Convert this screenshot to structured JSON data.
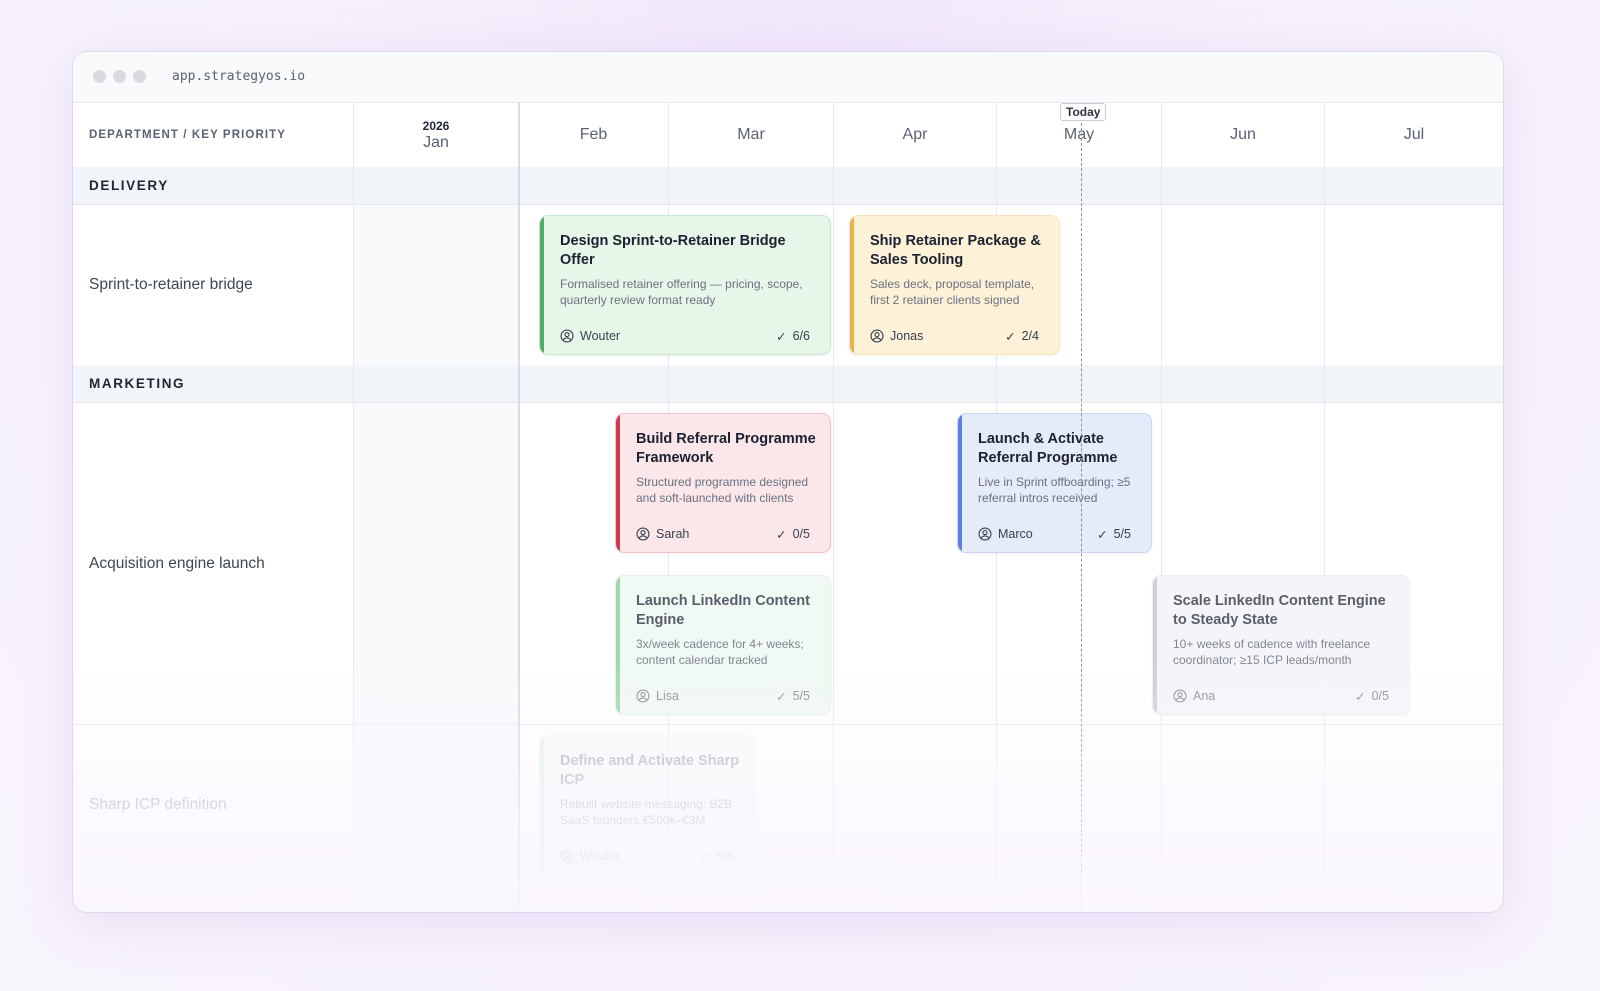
{
  "window": {
    "url": "app.strategyos.io"
  },
  "timeline": {
    "header_label": "DEPARTMENT / KEY PRIORITY",
    "year": "2026",
    "months": [
      "Jan",
      "Feb",
      "Mar",
      "Apr",
      "May",
      "Jun",
      "Jul"
    ],
    "today_label": "Today"
  },
  "sections": [
    {
      "name": "DELIVERY",
      "priorities": [
        {
          "label": "Sprint-to-retainer bridge",
          "cards": [
            {
              "title": "Design Sprint-to-Retainer Bridge Offer",
              "description": "Formalised retainer offering — pricing, scope, quarterly review format ready",
              "owner": "Wouter",
              "progress": "6/6",
              "accent": "#4caf63",
              "fill": "#e6f7ea"
            },
            {
              "title": "Ship Retainer Package & Sales Tooling",
              "description": "Sales deck, proposal template, first 2 retainer clients signed",
              "owner": "Jonas",
              "progress": "2/4",
              "accent": "#e8b44a",
              "fill": "#fdf1d8"
            }
          ]
        }
      ]
    },
    {
      "name": "MARKETING",
      "priorities": [
        {
          "label": "Acquisition engine launch",
          "cards": [
            {
              "title": "Build Referral Programme Framework",
              "description": "Structured programme designed and soft-launched with clients",
              "owner": "Sarah",
              "progress": "0/5",
              "accent": "#d0394f",
              "fill": "#fbe6ea"
            },
            {
              "title": "Launch & Activate Referral Programme",
              "description": "Live in Sprint offboarding; ≥5 referral intros received",
              "owner": "Marco",
              "progress": "5/5",
              "accent": "#5b7fe0",
              "fill": "#e6ebfa"
            },
            {
              "title": "Launch LinkedIn Content Engine",
              "description": "3x/week cadence for 4+ weeks; content calendar tracked",
              "owner": "Lisa",
              "progress": "5/5",
              "accent": "#8fd39c",
              "fill": "#eef8f1"
            },
            {
              "title": "Scale LinkedIn Content Engine to Steady State",
              "description": "10+ weeks of cadence with freelance coordinator; ≥15 ICP leads/month",
              "owner": "Ana",
              "progress": "0/5",
              "accent": "#c5c9d4",
              "fill": "#f4f4f8"
            }
          ]
        },
        {
          "label": "Sharp ICP definition",
          "cards": [
            {
              "title": "Define and Activate Sharp ICP",
              "description": "Rebuilt website messaging; B2B SaaS founders €500k–€3M",
              "owner": "Wouter",
              "progress": "5/5",
              "accent": "#bfe3c6",
              "fill": "#f2f8f4"
            }
          ]
        }
      ]
    }
  ]
}
